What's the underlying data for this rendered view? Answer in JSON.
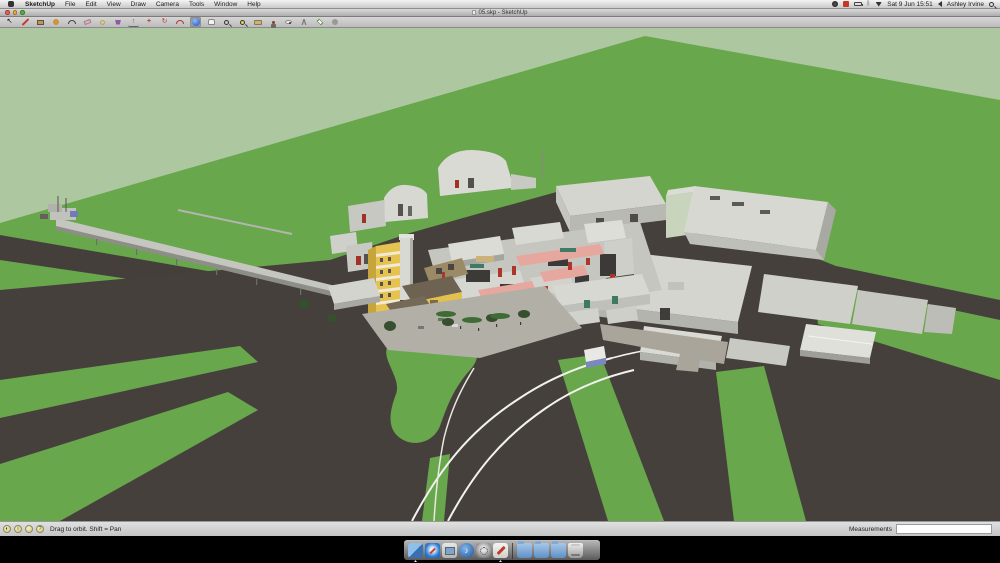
{
  "menubar": {
    "items": [
      {
        "label": "SketchUp"
      },
      {
        "label": "File"
      },
      {
        "label": "Edit"
      },
      {
        "label": "View"
      },
      {
        "label": "Draw"
      },
      {
        "label": "Camera"
      },
      {
        "label": "Tools"
      },
      {
        "label": "Window"
      },
      {
        "label": "Help"
      }
    ],
    "clock": "Sat 9 Jun 15:51",
    "user": "Ashley Irvine"
  },
  "window": {
    "title": "05.skp - SketchUp"
  },
  "toolbar": {
    "selected_tool": "orbit",
    "tools": [
      "select",
      "line",
      "rectangle",
      "circle",
      "arc",
      "eraser",
      "tape-measure",
      "paint-bucket",
      "push-pull",
      "move",
      "rotate",
      "offset",
      "orbit",
      "pan",
      "zoom",
      "zoom-extents",
      "previous-view",
      "position-camera",
      "look-around",
      "walk",
      "section-plane",
      "model-info"
    ]
  },
  "viewport": {
    "scene": "3D model of industrial factory complex on green site with dark access roads and loading pier",
    "colors": {
      "sky": "#adc7a0",
      "grass": "#68a74c",
      "road": "#453f3c",
      "building_light": "#d8d8d2",
      "building_shade": "#b0b0aa",
      "accent_yellow": "#e6c350",
      "accent_pink": "#e6a79f",
      "accent_red": "#ab3629",
      "curb_white": "#f2f2ee"
    }
  },
  "statusbar": {
    "hint": "Drag to orbit.  Shift = Pan",
    "measurements_label": "Measurements",
    "measurements_value": ""
  },
  "dock": {
    "items": [
      "finder",
      "safari",
      "preview",
      "itunes",
      "system-preferences",
      "sketchup",
      "folder-1",
      "folder-2",
      "folder-3",
      "trash"
    ]
  }
}
